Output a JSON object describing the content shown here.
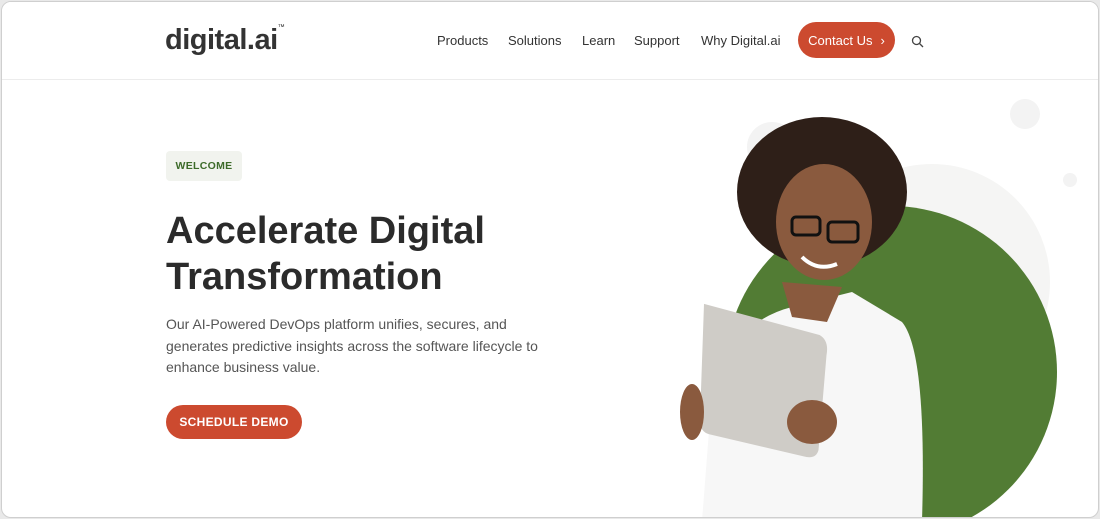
{
  "header": {
    "logo": "digital.ai",
    "logo_tm": "™",
    "nav": [
      "Products",
      "Solutions",
      "Learn",
      "Support",
      "Why Digital.ai"
    ],
    "contact_label": "Contact Us",
    "contact_icon": "chevron-right-icon",
    "search_icon": "search-icon"
  },
  "hero": {
    "badge": "WELCOME",
    "title_line1": "Accelerate Digital",
    "title_line2": "Transformation",
    "description": "Our AI-Powered DevOps platform unifies, secures, and generates predictive insights across the software lifecycle to enhance business value.",
    "cta": "SCHEDULE DEMO"
  },
  "colors": {
    "accent": "#cc4a2f",
    "brand_green": "#527c34",
    "text": "#2b2b2b"
  }
}
